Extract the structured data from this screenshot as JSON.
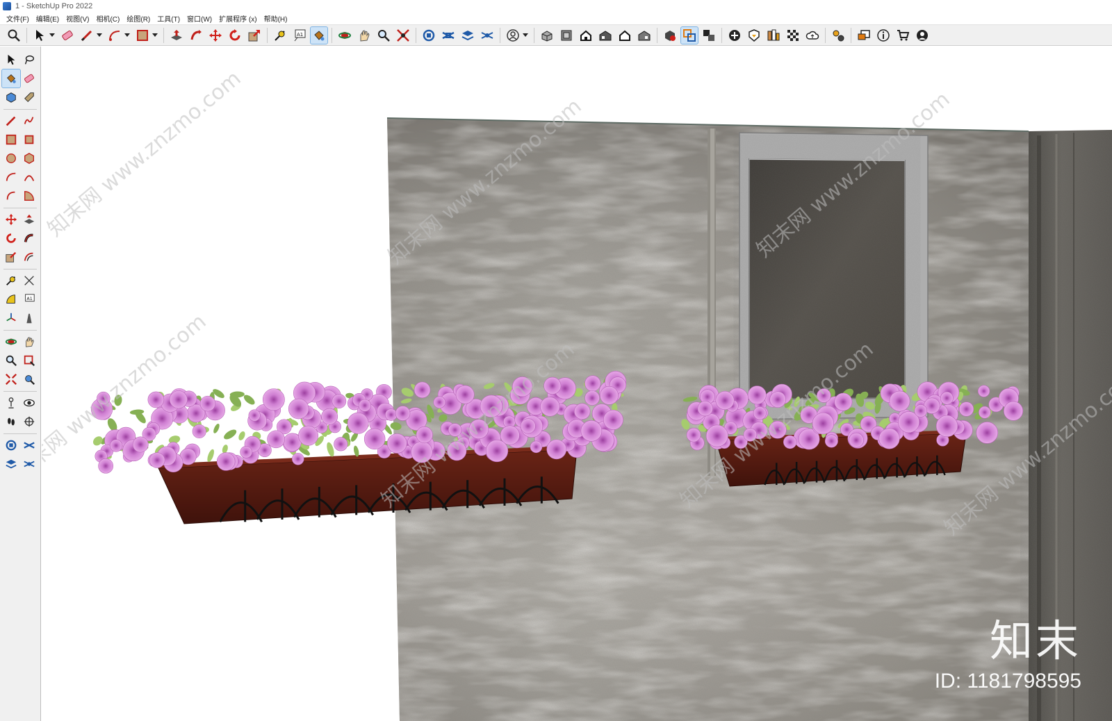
{
  "window": {
    "title": "1 - SketchUp Pro 2022"
  },
  "menubar": {
    "items": [
      {
        "label": "文件(F)"
      },
      {
        "label": "编辑(E)"
      },
      {
        "label": "视图(V)"
      },
      {
        "label": "相机(C)"
      },
      {
        "label": "绘图(R)"
      },
      {
        "label": "工具(T)"
      },
      {
        "label": "窗口(W)"
      },
      {
        "label": "扩展程序 (x)"
      },
      {
        "label": "帮助(H)"
      }
    ]
  },
  "toolbar": {
    "tools": [
      "zoom-extents-icon",
      "select-icon",
      "eraser-icon",
      "pencil-line-icon",
      "arc-icon",
      "rectangle-icon",
      "push-pull-icon",
      "follow-me-icon",
      "move-icon",
      "rotate-icon",
      "scale-icon",
      "tape-measure-icon",
      "text-icon",
      "paint-bucket-icon",
      "orbit-icon",
      "pan-icon",
      "zoom-icon",
      "zoom-window-icon",
      "section-plane-icon",
      "display-section-planes-icon",
      "display-section-cuts-icon",
      "display-section-fill-icon",
      "user-account-icon",
      "iso-view-icon",
      "top-view-icon",
      "front-view-icon",
      "right-view-icon",
      "back-view-icon",
      "left-view-icon",
      "solid-tools-icon",
      "outer-shell-icon",
      "intersect-icon",
      "add-location-icon",
      "sandbox-icon",
      "extension-warehouse-icon",
      "materials-icon",
      "cloud-icon",
      "settings-icon",
      "layout-icon",
      "info-icon",
      "cart-icon",
      "profile-icon"
    ],
    "active_tool": "paint-bucket-icon"
  },
  "left_toolbar": {
    "active_tool": "paint-bucket-icon"
  },
  "viewport": {
    "watermark_text": "知末网 www.znzmo.com",
    "brand_logo": "知末",
    "brand_id": "ID: 1181798595"
  },
  "colors": {
    "accent_active": "#cde3f7",
    "wall": "#8f8b84",
    "planter": "#5a1d12",
    "flower": "#d58bd6",
    "leaf": "#9dc46a",
    "window_frame": "#b2b2b2",
    "window_glass": "#4b4844"
  }
}
